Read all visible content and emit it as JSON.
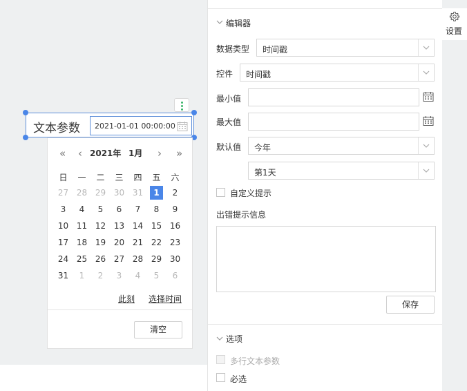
{
  "canvas": {
    "widget": {
      "label": "文本参数",
      "value": "2021-01-01 00:00:00"
    },
    "calendar": {
      "year_label": "2021年",
      "month_label": "1月",
      "nav_prev_year": "«",
      "nav_prev_month": "‹",
      "nav_next_month": "›",
      "nav_next_year": "»",
      "weekdays": [
        "日",
        "一",
        "二",
        "三",
        "四",
        "五",
        "六"
      ],
      "weeks": [
        [
          {
            "d": "27",
            "o": true
          },
          {
            "d": "28",
            "o": true
          },
          {
            "d": "29",
            "o": true
          },
          {
            "d": "30",
            "o": true
          },
          {
            "d": "31",
            "o": true
          },
          {
            "d": "1",
            "s": true
          },
          {
            "d": "2"
          }
        ],
        [
          {
            "d": "3"
          },
          {
            "d": "4"
          },
          {
            "d": "5"
          },
          {
            "d": "6"
          },
          {
            "d": "7"
          },
          {
            "d": "8"
          },
          {
            "d": "9"
          }
        ],
        [
          {
            "d": "10"
          },
          {
            "d": "11"
          },
          {
            "d": "12"
          },
          {
            "d": "13"
          },
          {
            "d": "14"
          },
          {
            "d": "15"
          },
          {
            "d": "16"
          }
        ],
        [
          {
            "d": "17"
          },
          {
            "d": "18"
          },
          {
            "d": "19"
          },
          {
            "d": "20"
          },
          {
            "d": "21"
          },
          {
            "d": "22"
          },
          {
            "d": "23"
          }
        ],
        [
          {
            "d": "24"
          },
          {
            "d": "25"
          },
          {
            "d": "26"
          },
          {
            "d": "27"
          },
          {
            "d": "28"
          },
          {
            "d": "29"
          },
          {
            "d": "30"
          }
        ],
        [
          {
            "d": "31"
          },
          {
            "d": "1",
            "o": true
          },
          {
            "d": "2",
            "o": true
          },
          {
            "d": "3",
            "o": true
          },
          {
            "d": "4",
            "o": true
          },
          {
            "d": "5",
            "o": true
          },
          {
            "d": "6",
            "o": true
          }
        ]
      ],
      "now_link": "此刻",
      "select_time_link": "选择时间",
      "clear_button": "清空"
    }
  },
  "panel": {
    "editor_section_title": "编辑器",
    "data_type_label": "数据类型",
    "data_type_value": "时间戳",
    "control_label": "控件",
    "control_value": "时间戳",
    "min_label": "最小值",
    "max_label": "最大值",
    "default_label": "默认值",
    "default_value": "今年",
    "default_day_value": "第1天",
    "custom_hint_label": "自定义提示",
    "error_hint_label": "出错提示信息",
    "save_button": "保存",
    "options_section_title": "选项",
    "multiline_label": "多行文本参数",
    "required_label": "必选"
  },
  "right_strip": {
    "settings_label": "设置",
    "icon": "gear-icon"
  },
  "colors": {
    "accent": "#4a86e8",
    "selection_border": "#5b8dd9",
    "handle_green": "#3bb56a"
  }
}
